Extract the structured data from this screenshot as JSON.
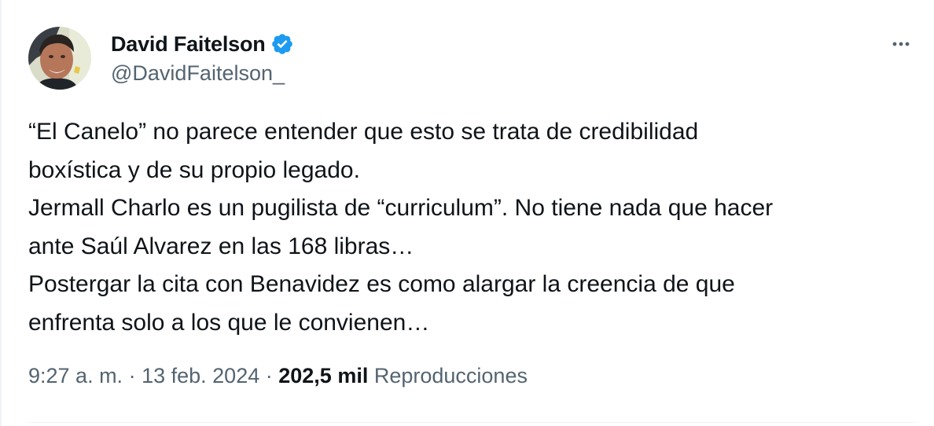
{
  "author": {
    "display_name": "David Faitelson",
    "handle": "@DavidFaitelson_",
    "verified_icon": "verified-badge-icon",
    "avatar": "profile-photo"
  },
  "actions": {
    "more_icon": "more-horizontal-icon"
  },
  "tweet": {
    "lines": [
      "“El Canelo” no parece entender que esto se trata de credibilidad",
      "boxística y de su propio legado.",
      "Jermall Charlo es un pugilista de “curriculum”.  No tiene nada que hacer",
      "ante Saúl Alvarez en las 168 libras…",
      "Postergar la cita con Benavidez es como alargar la creencia de que",
      "enfrenta solo a los que le convienen…"
    ]
  },
  "meta": {
    "time": "9:27 a. m.",
    "separator": "·",
    "date": "13 feb. 2024",
    "views_count": "202,5 mil",
    "views_label": "Reproducciones"
  },
  "colors": {
    "text": "#0f1419",
    "secondary": "#536471",
    "verified": "#1d9bf0",
    "divider": "#eff3f4"
  }
}
